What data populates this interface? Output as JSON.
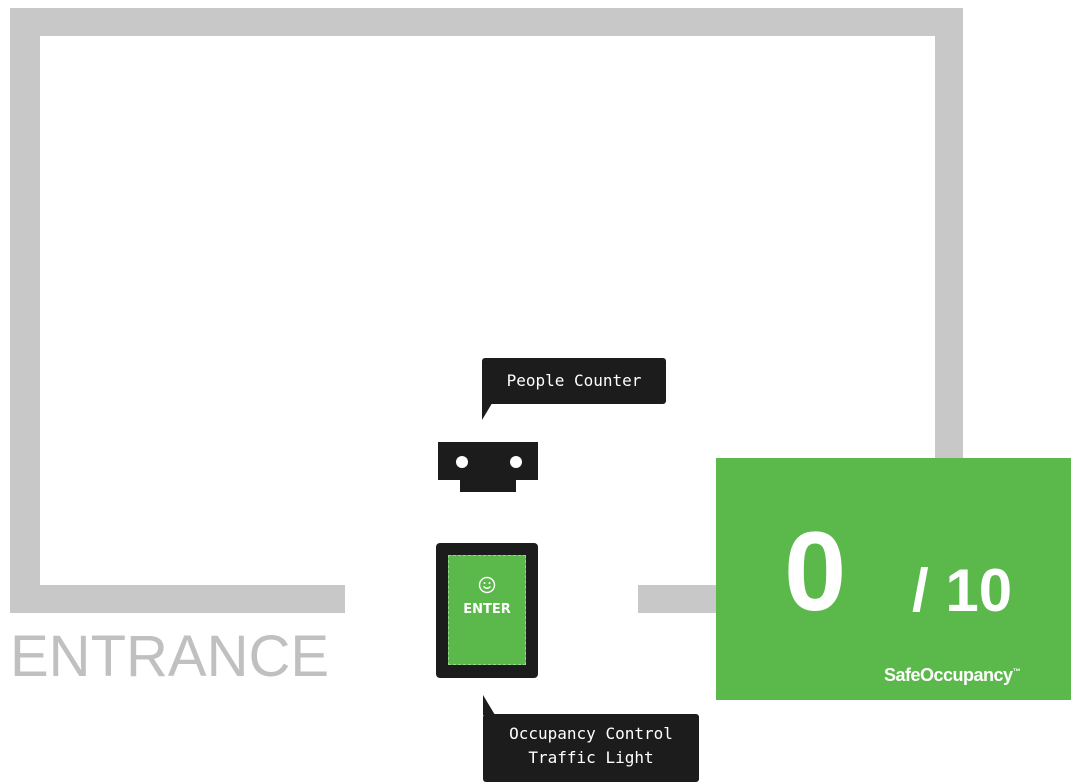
{
  "entrance": {
    "label": "ENTRANCE"
  },
  "people_counter": {
    "callout": "People Counter",
    "icon": "camera-sensor-icon"
  },
  "traffic_light": {
    "callout_line1": "Occupancy Control",
    "callout_line2": "Traffic Light",
    "screen_text": "ENTER",
    "screen_icon": "smiley-face-icon",
    "screen_color": "#5bb84b"
  },
  "occupancy_display": {
    "count": "0",
    "max": "/ 10",
    "brand": "SafeOccupancy",
    "trademark": "™",
    "color": "#5bb84b"
  },
  "colors": {
    "wall": "#c8c8c8",
    "device": "#1c1c1c",
    "status_green": "#5bb84b"
  }
}
